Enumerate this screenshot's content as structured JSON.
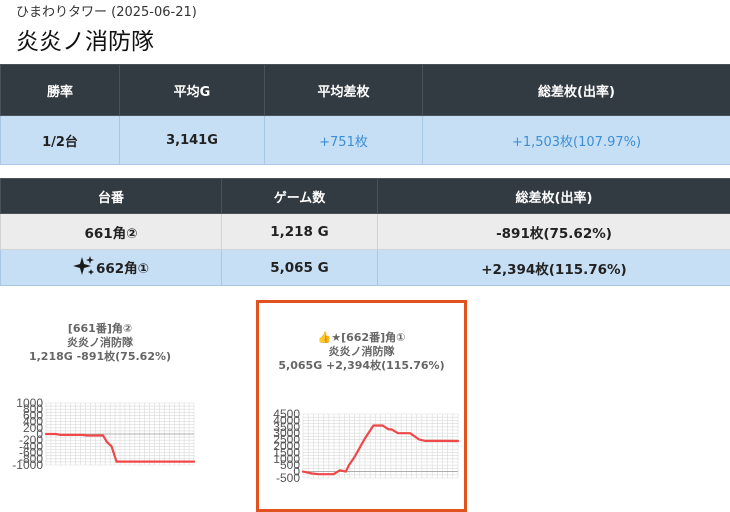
{
  "header": {
    "subtitle": "ひまわりタワー (2025-06-21)",
    "title": "炎炎ノ消防隊"
  },
  "summary": {
    "columns": [
      "勝率",
      "平均G",
      "平均差枚",
      "総差枚(出率)"
    ],
    "win_rate": "1/2台",
    "avg_games": "3,141G",
    "avg_diff": "+751枚",
    "total_diff": "+1,503枚(107.97%)"
  },
  "machines": {
    "columns": [
      "台番",
      "ゲーム数",
      "総差枚(出率)"
    ],
    "rows": [
      {
        "number": "661角②",
        "games": "1,218 G",
        "diff": "-891枚(75.62%)",
        "highlighted": false
      },
      {
        "number": "662角①",
        "games": "5,065 G",
        "diff": "+2,394枚(115.76%)",
        "highlighted": true,
        "icon": "sparkle-icon"
      }
    ]
  },
  "colors": {
    "header_bg": "#333b42",
    "row_blue": "#c7dff4",
    "accent": "#3c8fd6",
    "highlight_border": "#e2521f",
    "line": "#f04848"
  },
  "chart_data": [
    {
      "type": "line",
      "title": "[661番]角②",
      "subtitle_1": "炎炎ノ消防隊",
      "subtitle_2": "1,218G -891枚(75.62%)",
      "yticks": [
        "1000",
        "800",
        "600",
        "400",
        "200",
        "0",
        "-200",
        "-400",
        "-600",
        "-800",
        "-1000"
      ],
      "ylim": [
        -1000,
        1000
      ],
      "xlim": [
        0,
        1218
      ],
      "grid": true,
      "x": [
        0,
        80,
        120,
        300,
        340,
        470,
        500,
        540,
        580,
        1218
      ],
      "values": [
        0,
        0,
        -30,
        -30,
        -50,
        -50,
        -250,
        -400,
        -890,
        -891
      ]
    },
    {
      "type": "line",
      "title": "👍★[662番]角①",
      "subtitle_1": "炎炎ノ消防隊",
      "subtitle_2": "5,065G +2,394枚(115.76%)",
      "yticks": [
        "4500",
        "4000",
        "3500",
        "3000",
        "2500",
        "2000",
        "1500",
        "1000",
        "500",
        "0",
        "-500"
      ],
      "ylim": [
        -500,
        4500
      ],
      "xlim": [
        0,
        5065
      ],
      "grid": true,
      "x": [
        0,
        300,
        500,
        1000,
        1200,
        1400,
        1500,
        1700,
        2000,
        2300,
        2600,
        2800,
        2900,
        3100,
        3300,
        3500,
        3800,
        4000,
        4300,
        4600,
        5065
      ],
      "values": [
        0,
        -150,
        -200,
        -200,
        100,
        0,
        500,
        1200,
        2500,
        3600,
        3600,
        3300,
        3300,
        3000,
        3000,
        3000,
        2500,
        2400,
        2400,
        2400,
        2394
      ]
    }
  ]
}
